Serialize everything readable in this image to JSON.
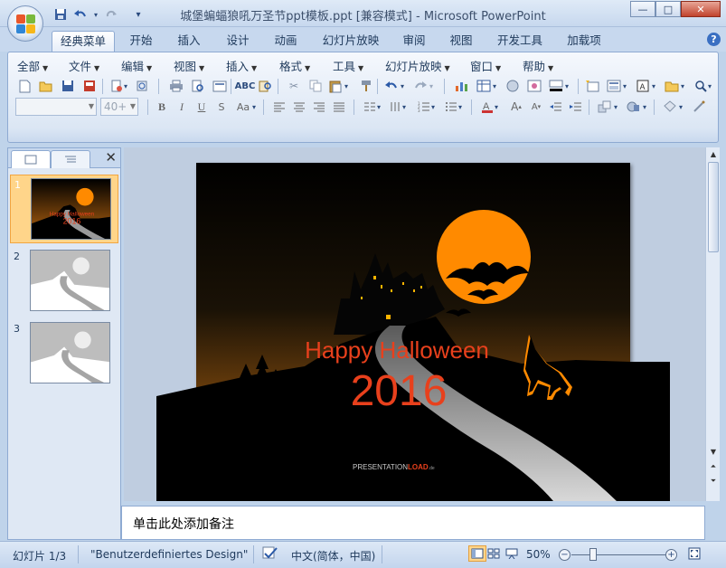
{
  "window": {
    "title": "城堡蝙蝠狼吼万圣节ppt模板.ppt [兼容模式] - Microsoft PowerPoint",
    "buttons": {
      "minimize": "—",
      "maximize": "□",
      "close": "✕"
    }
  },
  "quick_access": {
    "save": "save-icon",
    "undo": "undo-icon",
    "redo": "redo-icon",
    "customize": "▾"
  },
  "ribbon_tabs": [
    "经典菜单",
    "开始",
    "插入",
    "设计",
    "动画",
    "幻灯片放映",
    "审阅",
    "视图",
    "开发工具",
    "加载项"
  ],
  "active_tab": "经典菜单",
  "classic_menu": [
    "全部",
    "文件",
    "编辑",
    "视图",
    "插入",
    "格式",
    "工具",
    "幻灯片放映",
    "窗口",
    "帮助"
  ],
  "font": {
    "name_placeholder": "",
    "size": "40+"
  },
  "slides_panel": {
    "tab_slides": "slides-icon",
    "tab_outline": "outline-icon",
    "close": "✕",
    "thumbnails": [
      {
        "number": "1",
        "selected": true
      },
      {
        "number": "2",
        "selected": false
      },
      {
        "number": "3",
        "selected": false
      }
    ]
  },
  "slide": {
    "title": "Happy Halloween",
    "year": "2016",
    "logo_left": "PRESENTATION",
    "logo_right": "LOAD",
    "logo_suffix": ".de"
  },
  "notes": {
    "placeholder": "单击此处添加备注"
  },
  "status": {
    "slide_info": "幻灯片 1/3",
    "theme": "\"Benutzerdefiniertes Design\"",
    "language": "中文(简体，中国)",
    "zoom": "50%"
  },
  "colors": {
    "accent_orange": "#ff8a00",
    "title_red": "#e8401c",
    "ribbon_blue": "#c7d8ee"
  }
}
